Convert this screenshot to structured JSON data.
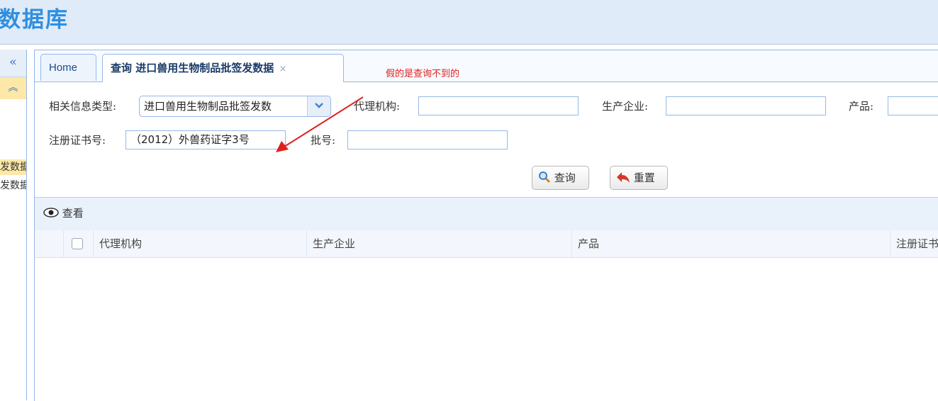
{
  "header": {
    "title": "数据库"
  },
  "sidebar": {
    "collapse_icon": "«",
    "up_icon": "︽",
    "items": [
      {
        "label": "发数据"
      },
      {
        "label": "发数据"
      }
    ]
  },
  "tabs": [
    {
      "label": "Home"
    },
    {
      "label": "查询 进口兽用生物制品批签发数据",
      "close": "×"
    }
  ],
  "annotation": "假的是查询不到的",
  "form": {
    "info_type_label": "相关信息类型:",
    "info_type_value": "进口兽用生物制品批签发数",
    "agent_label": "代理机构:",
    "agent_value": "",
    "manufacturer_label": "生产企业:",
    "manufacturer_value": "",
    "product_label": "产品:",
    "product_value": "",
    "registration_label": "注册证书号:",
    "registration_value": "（2012）外兽药证字3号",
    "batch_label": "批号:",
    "batch_value": ""
  },
  "buttons": {
    "query": "查询",
    "reset": "重置"
  },
  "toolbar": {
    "view": "查看"
  },
  "grid": {
    "columns": [
      "代理机构",
      "生产企业",
      "产品",
      "注册证书"
    ]
  },
  "colors": {
    "accent": "#2f8fe0",
    "annotation": "#e02020",
    "border": "#95b8e7"
  }
}
